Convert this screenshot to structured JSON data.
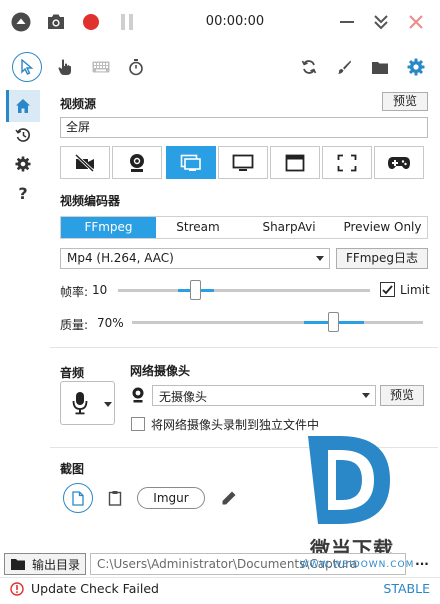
{
  "title_bar": {
    "timer": "00:00:00",
    "icons": [
      "circle-up-arrow-icon",
      "camera-icon",
      "record-icon",
      "pause-icon",
      "minimize-icon",
      "collapse-icon",
      "close-icon"
    ],
    "record_color": "#e0312f",
    "close_color": "#f08a8a"
  },
  "toolbar": {
    "left_icons": [
      "cursor-icon",
      "click-hand-icon",
      "keyboard-icon",
      "timer-icon"
    ],
    "right_icons": [
      "refresh-icon",
      "brush-icon",
      "folder-icon",
      "gear-icon"
    ],
    "accent": "#2a87c8"
  },
  "sidebar": {
    "items": [
      "home-icon",
      "history-icon",
      "settings-icon",
      "help-icon"
    ],
    "help_glyph": "?"
  },
  "video_source": {
    "label": "视频源",
    "preview_button": "预览",
    "value": "全屏",
    "tiles": [
      "no-video-icon",
      "webcam-icon",
      "screen-icon",
      "monitor-icon",
      "window-icon",
      "region-icon",
      "gamepad-icon"
    ],
    "active_tile": 2
  },
  "encoder": {
    "label": "视频编码器",
    "tabs": [
      "FFmpeg",
      "Stream",
      "SharpAvi",
      "Preview Only"
    ],
    "active_tab": 0,
    "format": "Mp4 (H.264, AAC)",
    "log_button": "FFmpeg日志",
    "framerate_label": "帧率:",
    "framerate_value": "10",
    "limit_label": "Limit",
    "limit_checked": true,
    "quality_label": "质量:",
    "quality_value": "70%"
  },
  "audio": {
    "label": "音频"
  },
  "webcam": {
    "label": "网络摄像头",
    "value": "无摄像头",
    "preview_button": "预览",
    "separate_file_label": "将网络摄像头录制到独立文件中",
    "separate_file_checked": false
  },
  "screenshot": {
    "label": "截图",
    "imgur_button": "Imgur"
  },
  "output": {
    "label": "输出目录",
    "path": "C:\\Users\\Administrator\\Documents\\Captura",
    "more": "..."
  },
  "status": {
    "message": "Update Check Failed",
    "channel": "STABLE"
  },
  "watermark": {
    "text": "微当下载",
    "url": "WWW.WEIDOWN.COM",
    "brand_color": "#2a87c8"
  }
}
